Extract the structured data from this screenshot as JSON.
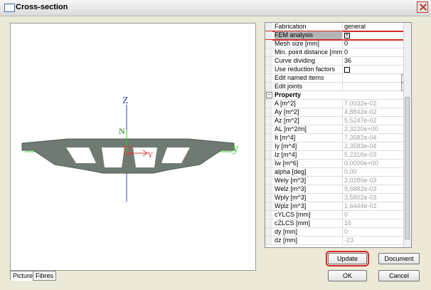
{
  "window": {
    "title": "Cross-section",
    "close_label": ""
  },
  "canvas": {
    "axis_z": "Z",
    "axis_y_big": "y",
    "axis_y_small": "Y",
    "axis_n": "N",
    "section_color": "#6f7a73",
    "axis_blue": "#2d3fbf",
    "axis_green": "#2bd02b",
    "local_red": "#e23b3b"
  },
  "tabs": {
    "picture": "Picture",
    "fibres": "Fibres"
  },
  "properties": {
    "rows": [
      {
        "label": "Fabrication",
        "value": "general",
        "kind": "dropdown"
      },
      {
        "label": "FEM analysis",
        "value": "",
        "kind": "checkbox",
        "checked": true,
        "highlight": true
      },
      {
        "label": "Mesh size [mm]",
        "value": "0"
      },
      {
        "label": "Min. point distance [mm]",
        "value": "0"
      },
      {
        "label": "Curve dividing",
        "value": "36"
      },
      {
        "label": "Use reduction factors",
        "value": "",
        "kind": "checkbox",
        "checked": false
      },
      {
        "label": "Edit named items",
        "value": "",
        "kind": "ellipsis"
      },
      {
        "label": "Edit joints",
        "value": "",
        "kind": "ellipsis"
      },
      {
        "label": "Property",
        "value": "",
        "kind": "category"
      },
      {
        "label": "A [m^2]",
        "value": "7,0032e-02",
        "ro": true
      },
      {
        "label": "Ay [m^2]",
        "value": "4,8842e-02",
        "ro": true
      },
      {
        "label": "Az [m^2]",
        "value": "5,5247e-02",
        "ro": true
      },
      {
        "label": "AL [m^2/m]",
        "value": "2,3220e+00",
        "ro": true
      },
      {
        "label": "It [m^4]",
        "value": "7,3582e-04",
        "ro": true
      },
      {
        "label": "Iy [m^4]",
        "value": "2,3583e-04",
        "ro": true
      },
      {
        "label": "Iz [m^4]",
        "value": "5,2316e-03",
        "ro": true
      },
      {
        "label": "Iw [m^6]",
        "value": "0,0000e+00",
        "ro": true
      },
      {
        "label": "alpha [deg]",
        "value": "0,00",
        "ro": true
      },
      {
        "label": "Wely [m^3]",
        "value": "2,0280e-03",
        "ro": true
      },
      {
        "label": "Welz [m^3]",
        "value": "9,6882e-03",
        "ro": true
      },
      {
        "label": "Wply [m^3]",
        "value": "3,5802e-03",
        "ro": true
      },
      {
        "label": "Wplz [m^3]",
        "value": "1,6444e-02",
        "ro": true
      },
      {
        "label": "cYLCS [mm]",
        "value": "0",
        "ro": true
      },
      {
        "label": "cZLCS [mm]",
        "value": "16",
        "ro": true
      },
      {
        "label": "dy [mm]",
        "value": "0",
        "ro": true
      },
      {
        "label": "dz [mm]",
        "value": "-23",
        "ro": true
      }
    ]
  },
  "buttons": {
    "update": "Update",
    "document": "Document",
    "ok": "OK",
    "cancel": "Cancel"
  },
  "colors": {
    "highlight": "#d62828"
  }
}
